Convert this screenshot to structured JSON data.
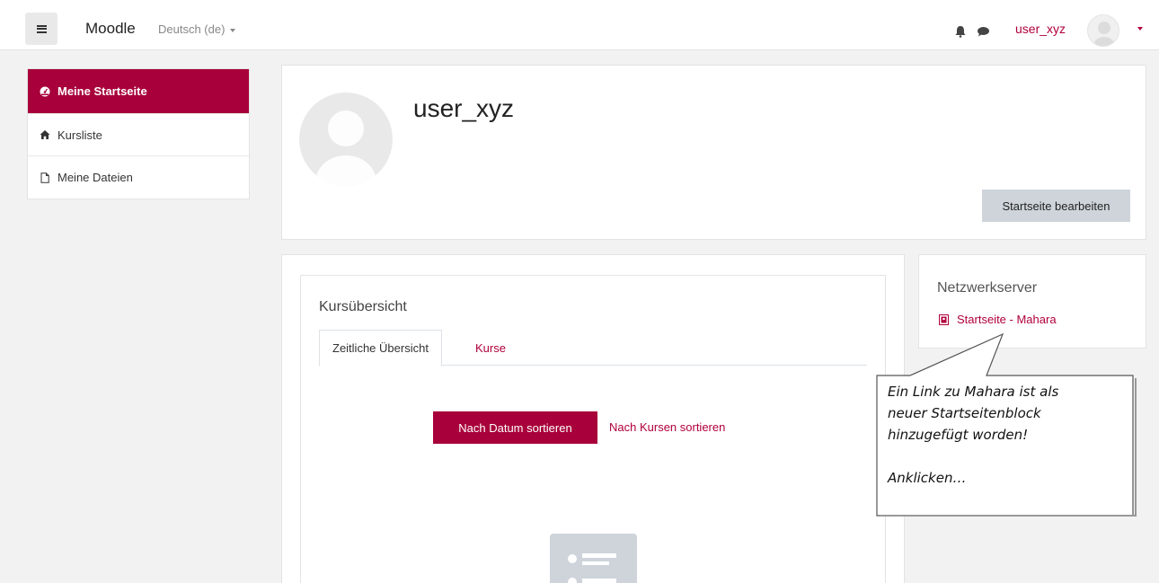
{
  "navbar": {
    "brand": "Moodle",
    "language": "Deutsch (de)",
    "username": "user_xyz"
  },
  "nav": {
    "items": [
      {
        "label": "Meine Startseite",
        "icon": "dashboard-icon",
        "active": true
      },
      {
        "label": "Kursliste",
        "icon": "home-icon",
        "active": false
      },
      {
        "label": "Meine Dateien",
        "icon": "file-icon",
        "active": false
      }
    ]
  },
  "profile": {
    "name": "user_xyz",
    "edit_button": "Startseite bearbeiten"
  },
  "course_overview": {
    "title": "Kursübersicht",
    "tabs": [
      "Zeitliche Übersicht",
      "Kurse"
    ],
    "sort_by_date": "Nach Datum sortieren",
    "sort_by_course": "Nach Kursen sortieren"
  },
  "network_block": {
    "title": "Netzwerkserver",
    "link": "Startseite - Mahara"
  },
  "callout": {
    "text": "Ein Link zu Mahara ist als\nneuer Startseitenblock\nhinzugefügt worden!\n\nAnklicken…"
  },
  "colors": {
    "accent": "#a8003a",
    "link": "#b0003a",
    "background": "#f2f2f2",
    "button_secondary": "#ced4da"
  }
}
